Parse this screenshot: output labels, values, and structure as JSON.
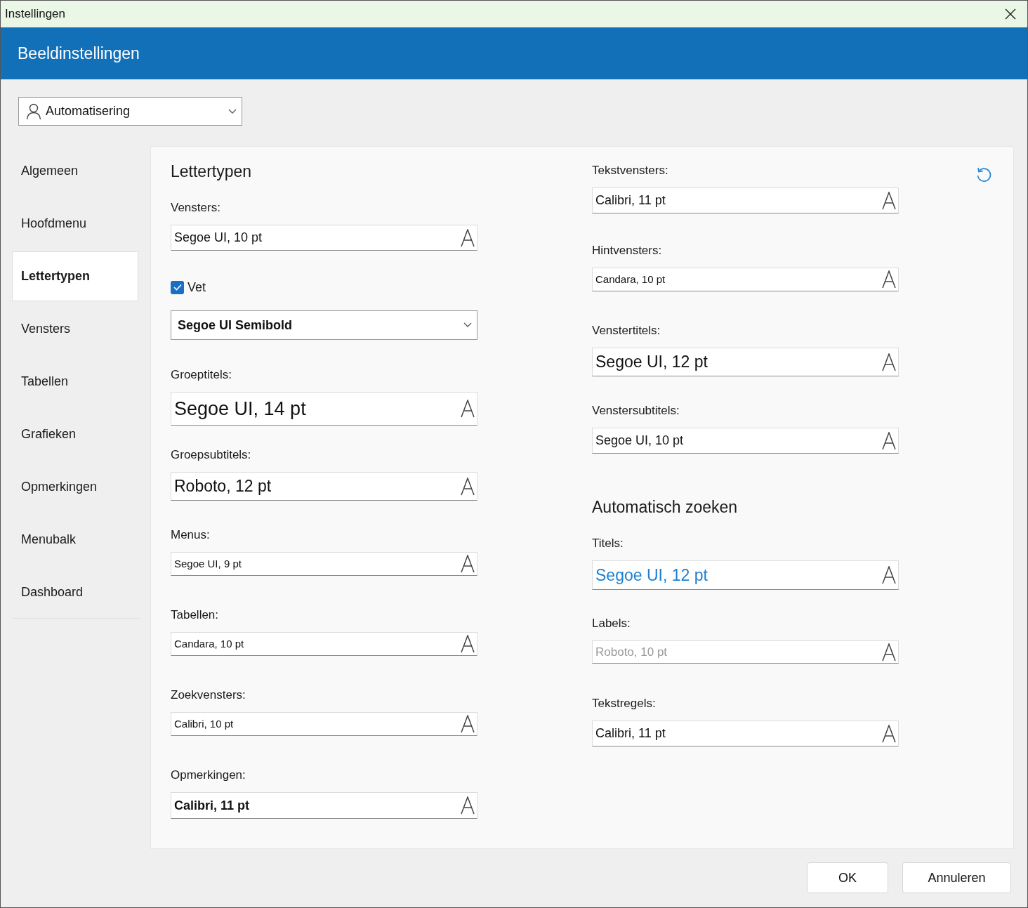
{
  "window": {
    "title": "Instellingen"
  },
  "header": {
    "title": "Beeldinstellingen"
  },
  "profile": {
    "value": "Automatisering"
  },
  "sidebar": {
    "items": [
      {
        "label": "Algemeen",
        "selected": false
      },
      {
        "label": "Hoofdmenu",
        "selected": false
      },
      {
        "label": "Lettertypen",
        "selected": true
      },
      {
        "label": "Vensters",
        "selected": false
      },
      {
        "label": "Tabellen",
        "selected": false
      },
      {
        "label": "Grafieken",
        "selected": false
      },
      {
        "label": "Opmerkingen",
        "selected": false
      },
      {
        "label": "Menubalk",
        "selected": false
      },
      {
        "label": "Dashboard",
        "selected": false
      }
    ]
  },
  "columns": [
    {
      "sections": [
        {
          "heading": "Lettertypen",
          "items": [
            {
              "kind": "normal",
              "label": "Vensters:",
              "value": "Segoe UI, 10 pt"
            },
            {
              "kind": "checkbox",
              "label": "Vet",
              "checked": true
            },
            {
              "kind": "select",
              "value": "Segoe UI Semibold"
            },
            {
              "kind": "large",
              "label": "Groeptitels:",
              "value": "Segoe UI, 14 pt"
            },
            {
              "kind": "medium",
              "label": "Groepsubtitels:",
              "value": "Roboto, 12 pt"
            },
            {
              "kind": "small",
              "label": "Menus:",
              "value": "Segoe UI, 9 pt"
            },
            {
              "kind": "small",
              "label": "Tabellen:",
              "value": "Candara, 10 pt"
            },
            {
              "kind": "small",
              "label": "Zoekvensters:",
              "value": "Calibri, 10 pt"
            },
            {
              "kind": "bold",
              "label": "Opmerkingen:",
              "value": "Calibri, 11 pt"
            }
          ]
        }
      ]
    },
    {
      "sections": [
        {
          "items": [
            {
              "kind": "normal",
              "label": "Tekstvensters:",
              "value": "Calibri, 11 pt"
            },
            {
              "kind": "small",
              "label": "Hintvensters:",
              "value": "Candara, 10 pt"
            },
            {
              "kind": "medium",
              "label": "Venstertitels:",
              "value": "Segoe UI, 12 pt"
            },
            {
              "kind": "normal",
              "label": "Venstersubtitels:",
              "value": "Segoe UI, 10 pt"
            }
          ]
        },
        {
          "heading": "Automatisch zoeken",
          "items": [
            {
              "kind": "accent",
              "label": "Titels:",
              "value": "Segoe UI, 12 pt"
            },
            {
              "kind": "muted",
              "label": "Labels:",
              "value": "Roboto, 10 pt"
            },
            {
              "kind": "normal",
              "label": "Tekstregels:",
              "value": "Calibri, 11 pt"
            }
          ]
        }
      ]
    }
  ],
  "buttons": [
    {
      "label": "OK"
    },
    {
      "label": "Annuleren"
    }
  ]
}
